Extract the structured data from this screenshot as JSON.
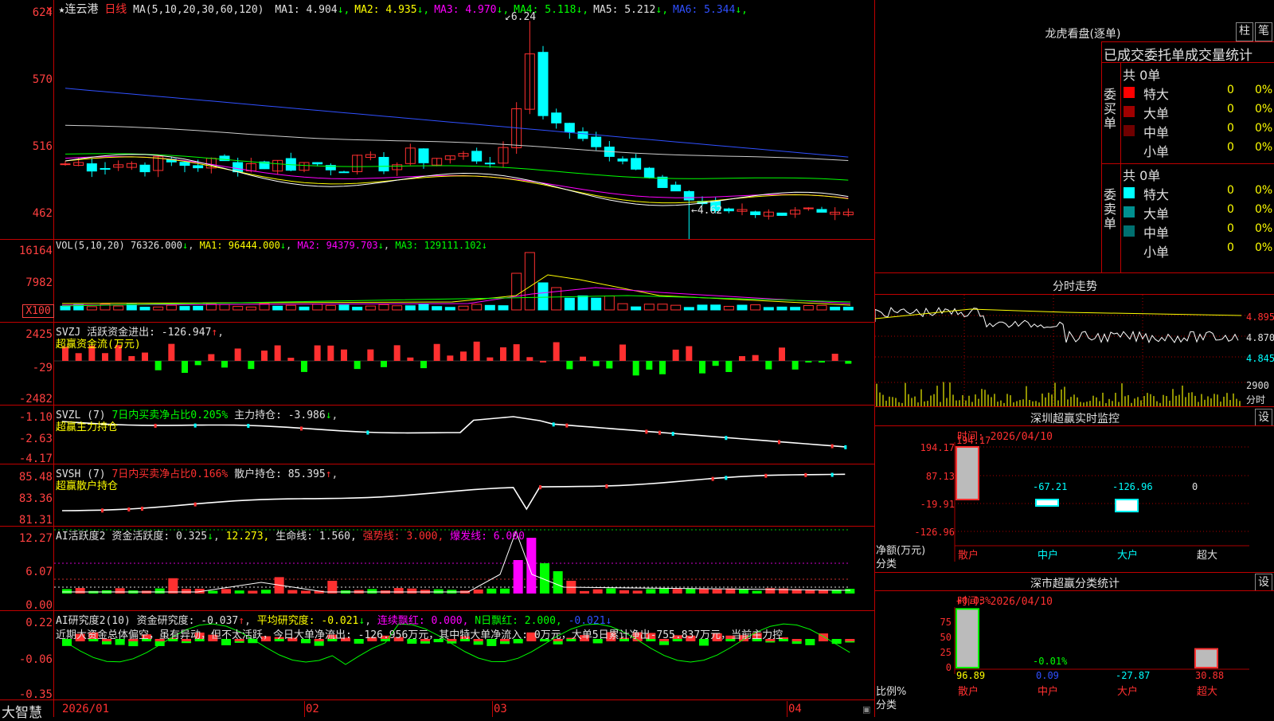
{
  "stock": {
    "star": "★",
    "name": "连云港",
    "period": "日线"
  },
  "main": {
    "ma_label": "MA(5,10,20,30,60,120)",
    "ma": [
      {
        "k": "MA1:",
        "v": "4.904",
        "c": "#e0e0e0"
      },
      {
        "k": "MA2:",
        "v": "4.935",
        "c": "#ffff00"
      },
      {
        "k": "MA3:",
        "v": "4.970",
        "c": "#ff00ff"
      },
      {
        "k": "MA4:",
        "v": "5.118",
        "c": "#00ff00"
      },
      {
        "k": "MA5:",
        "v": "5.212",
        "c": "#e0e0e0"
      },
      {
        "k": "MA6:",
        "v": "5.344",
        "c": "#3050ff"
      }
    ],
    "axis": [
      "624",
      "570",
      "516",
      "462"
    ],
    "high": "6.24",
    "low": "4.62"
  },
  "vol": {
    "label": "VOL(5,10,20)",
    "v": "76326.000",
    "ma1": "MA1: 96444.000",
    "ma2": "MA2: 94379.703",
    "ma3": "MA3: 129111.102",
    "axis": [
      "16164",
      "7982"
    ],
    "unit": "X100"
  },
  "svzj": {
    "label": "SVZJ",
    "text": "活跃资金进出: -126.947",
    "sub": "超赢资金流(万元)",
    "axis": [
      "2425",
      "-29",
      "-2482"
    ]
  },
  "svzl": {
    "label": "SVZL (7)",
    "t1": "7日内买卖净占比0.205%",
    "t2": "主力持仓: -3.986",
    "sub": "超赢主力持仓",
    "axis": [
      "-1.10",
      "-2.63",
      "-4.17"
    ]
  },
  "svsh": {
    "label": "SVSH (7)",
    "t1": "7日内买卖净占比0.166%",
    "t2": "散户持仓: 85.395",
    "sub": "超赢散户持仓",
    "axis": [
      "85.48",
      "83.36",
      "81.31"
    ]
  },
  "ai1": {
    "label": "AI活跃度2",
    "t1": "资金活跃度: 0.325",
    "t2": "12.273,",
    "t3": "生命线: 1.560,",
    "t4": "强势线: 3.000,",
    "t5": "爆发线: 6.000,",
    "axis": [
      "12.27",
      "6.07",
      "0.00"
    ]
  },
  "ai2": {
    "label": "AI研究度2(10)",
    "t1": "资金研究度: -0.037",
    "t2": "平均研究度: -0.021",
    "t3": "连续飘红: 0.000,",
    "t4": "N日飘红: 2.000,",
    "t5": "-0.021",
    "comment": "近期大资金总体偏空，虽有异动，但不太活跃，今日大单净流出: -126.956万元，其中特大单净流入: 0万元，大单5日累计净出-755.837万元，当前主力控",
    "axis": [
      "0.22",
      "-0.06",
      "-0.35"
    ]
  },
  "xaxis": [
    "2026/01",
    "02",
    "03",
    "04"
  ],
  "brand": "大智慧",
  "side": {
    "dragon": "龙虎看盘(逐单)",
    "btn1": "柱",
    "btn2": "笔",
    "tab_title": "已成交委托单成交量统计",
    "buy_label": "委买单",
    "sell_label": "委卖单",
    "buy_total": "共 0单",
    "sell_total": "共 0单",
    "rows_buy": [
      {
        "name": "特大",
        "n": "0",
        "p": "0%",
        "color": "#ff0000"
      },
      {
        "name": "大单",
        "n": "0",
        "p": "0%",
        "color": "#a00000"
      },
      {
        "name": "中单",
        "n": "0",
        "p": "0%",
        "color": "#700000"
      },
      {
        "name": "小单",
        "n": "0",
        "p": "0%",
        "color": ""
      }
    ],
    "rows_sell": [
      {
        "name": "特大",
        "n": "0",
        "p": "0%",
        "color": "#00ffff"
      },
      {
        "name": "大单",
        "n": "0",
        "p": "0%",
        "color": "#009090"
      },
      {
        "name": "中单",
        "n": "0",
        "p": "0%",
        "color": "#007070"
      },
      {
        "name": "小单",
        "n": "0",
        "p": "0%",
        "color": ""
      }
    ],
    "intraday_title": "分时走势",
    "intraday_axis": [
      "4.895",
      "4.870",
      "4.845"
    ],
    "intraday_vol": "2900",
    "intraday_vol_unit": "分时",
    "monitor_title": "深圳超赢实时监控",
    "monitor_btn": "设",
    "monitor_time": "时间: 2026/04/10",
    "monitor_axis": [
      "194.17",
      "87.13",
      "-19.91",
      "-126.96"
    ],
    "monitor_unit": "净额(万元)",
    "monitor_class": "分类",
    "monitor_bars": [
      {
        "cat": "散户",
        "val": "194.17",
        "num": 194.17,
        "cat_color": "#ff3030",
        "val_color": "#ff3030"
      },
      {
        "cat": "中户",
        "val": "-67.21",
        "num": -67.21,
        "cat_color": "#00ffff",
        "val_color": "#00ffff"
      },
      {
        "cat": "大户",
        "val": "-126.96",
        "num": -126.96,
        "cat_color": "#00ffff",
        "val_color": "#00ffff"
      },
      {
        "cat": "超大",
        "val": "0",
        "num": 0,
        "cat_color": "#e0e0e0",
        "val_color": "#e0e0e0"
      }
    ],
    "class_title": "深市超赢分类统计",
    "class_btn": "设",
    "class_time": "时间: 2026/04/10",
    "class_axis": [
      "75",
      "50",
      "25",
      "0"
    ],
    "class_unit": "比例%",
    "class_class": "分类",
    "class_top1": "+0.03%",
    "class_top2": "-0.01%",
    "class_bars": [
      {
        "cat": "散户",
        "val": "96.89",
        "num": 96.89,
        "cat_color": "#ff3030",
        "val_color": "#ffff00"
      },
      {
        "cat": "中户",
        "val": "0.09",
        "num": 0.09,
        "cat_color": "#ff3030",
        "val_color": "#3050ff"
      },
      {
        "cat": "大户",
        "val": "-27.87",
        "num": -27.87,
        "cat_color": "#ff3030",
        "val_color": "#00ffff"
      },
      {
        "cat": "超大",
        "val": "30.88",
        "num": 30.88,
        "cat_color": "#ff3030",
        "val_color": "#ff3030"
      }
    ]
  }
}
